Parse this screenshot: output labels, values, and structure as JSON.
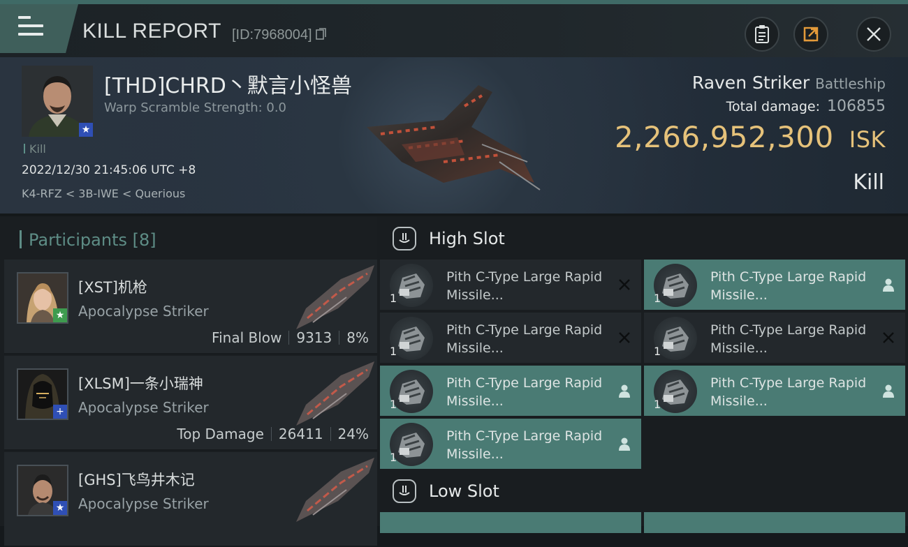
{
  "header": {
    "title": "KILL REPORT",
    "report_id": "[ID:7968004]"
  },
  "victim": {
    "name": "[THD]CHRD丶默言小怪兽",
    "warp_scramble": "Warp Scramble Strength: 0.0",
    "tag": "Kill",
    "timestamp": "2022/12/30 21:45:06 UTC +8",
    "location": "K4-RFZ < 3B-IWE < Querious",
    "ship": "Raven Striker",
    "ship_class": "Battleship",
    "total_damage_label": "Total damage:",
    "total_damage": "106855",
    "isk_value": "2,266,952,300",
    "isk_unit": "ISK",
    "result": "Kill"
  },
  "participants": {
    "header": "Participants [8]",
    "items": [
      {
        "name": "[XST]机枪",
        "ship": "Apocalypse Striker",
        "label": "Final Blow",
        "damage": "9313",
        "percent": "8%",
        "badge_color": "#3e9b4f"
      },
      {
        "name": "[XLSM]一条小瑞神",
        "ship": "Apocalypse Striker",
        "label": "Top Damage",
        "damage": "26411",
        "percent": "24%",
        "badge_color": "#2f4fb5"
      },
      {
        "name": "[GHS]飞鸟井木记",
        "ship": "Apocalypse Striker",
        "label": "",
        "damage": "",
        "percent": "",
        "badge_color": "#2f4fb5"
      }
    ]
  },
  "slots": {
    "high_slot_label": "High Slot",
    "low_slot_label": "Low Slot",
    "modules": [
      {
        "name": "Pith C-Type Large Rapid Missile...",
        "qty": "1",
        "status": "destroyed-icon"
      },
      {
        "name": "Pith C-Type Large Rapid Missile...",
        "qty": "1",
        "status": "dropped-icon"
      },
      {
        "name": "Pith C-Type Large Rapid Missile...",
        "qty": "1",
        "status": "destroyed-icon"
      },
      {
        "name": "Pith C-Type Large Rapid Missile...",
        "qty": "1",
        "status": "destroyed-icon"
      },
      {
        "name": "Pith C-Type Large Rapid Missile...",
        "qty": "1",
        "status": "dropped-icon"
      },
      {
        "name": "Pith C-Type Large Rapid Missile...",
        "qty": "1",
        "status": "dropped-icon"
      },
      {
        "name": "Pith C-Type Large Rapid Missile...",
        "qty": "1",
        "status": "dropped-icon"
      }
    ]
  },
  "colors": {
    "accent_teal": "#4a7b74",
    "isk_gold": "#e6c27a"
  }
}
